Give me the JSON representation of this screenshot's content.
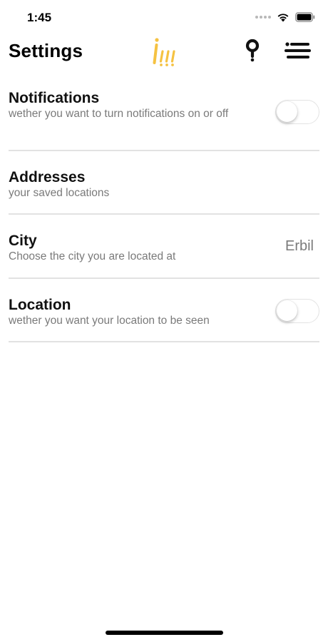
{
  "status_bar": {
    "time": "1:45"
  },
  "header": {
    "title": "Settings",
    "logo_icon": "brand-logo-icon",
    "search_icon": "search-icon",
    "menu_icon": "menu-icon",
    "accent_color": "#f5c242"
  },
  "settings": {
    "notifications": {
      "title": "Notifications",
      "description": "wether you want to turn notifications on or off",
      "enabled": false
    },
    "addresses": {
      "title": "Addresses",
      "description": "your saved locations"
    },
    "city": {
      "title": "City",
      "description": "Choose the city you are located at",
      "value": "Erbil"
    },
    "location": {
      "title": "Location",
      "description": "wether you want your location to be seen",
      "enabled": false
    }
  }
}
